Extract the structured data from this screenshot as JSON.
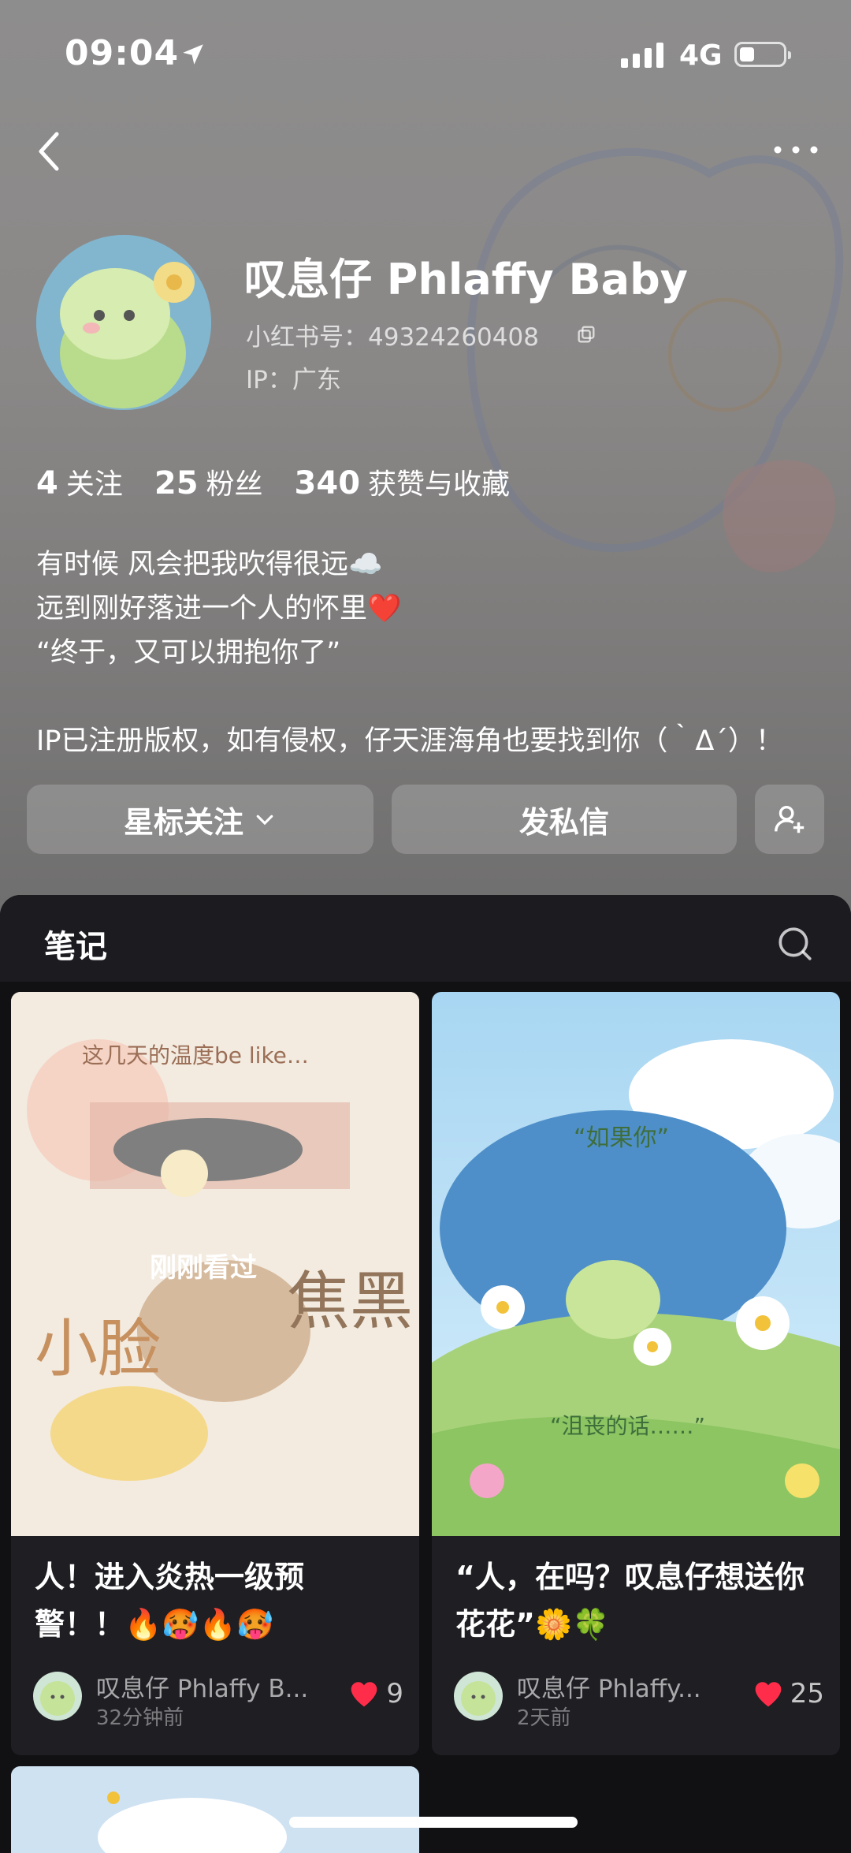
{
  "status_bar": {
    "time": "09:04",
    "network": "4G"
  },
  "profile": {
    "name": "叹息仔 Phlaffy Baby",
    "red_id_label": "小红书号：49324260408",
    "ip_label": "IP：广东",
    "stats": [
      {
        "value": "4",
        "label": "关注"
      },
      {
        "value": "25",
        "label": "粉丝"
      },
      {
        "value": "340",
        "label": "获赞与收藏"
      }
    ],
    "bio_lines": [
      "有时候 风会把我吹得很远☁️",
      "远到刚好落进一个人的怀里❤️",
      "“终于，又可以拥抱你了”",
      "",
      "IP已注册版权，如有侵权，仔天涯海角也要找到你（｀Δ´）！"
    ]
  },
  "actions": {
    "follow_label": "星标关注",
    "message_label": "发私信"
  },
  "tabs": {
    "notes_label": "笔记"
  },
  "notes": [
    {
      "title_line1": "人！进入炎热一级预",
      "title_line2": "警！！🔥🥵🔥🥵",
      "author": "叹息仔 Phlaffy B...",
      "time": "32分钟前",
      "likes": "9",
      "overlay": "刚刚看过",
      "image_texts": [
        "这几天的温度be like…",
        "小脸",
        "焦黑"
      ]
    },
    {
      "title_line1": "“人，在吗？叹息仔想送你",
      "title_line2": "花花”🌼🍀",
      "author": "叹息仔 Phlaffy...",
      "time": "2天前",
      "likes": "25",
      "image_texts": [
        "“如果你”",
        "“沮丧的话……”"
      ]
    }
  ],
  "colors": {
    "like_red": "#ff2d4a",
    "sheet_bg": "#111114",
    "card_bg": "#1e1e23"
  }
}
